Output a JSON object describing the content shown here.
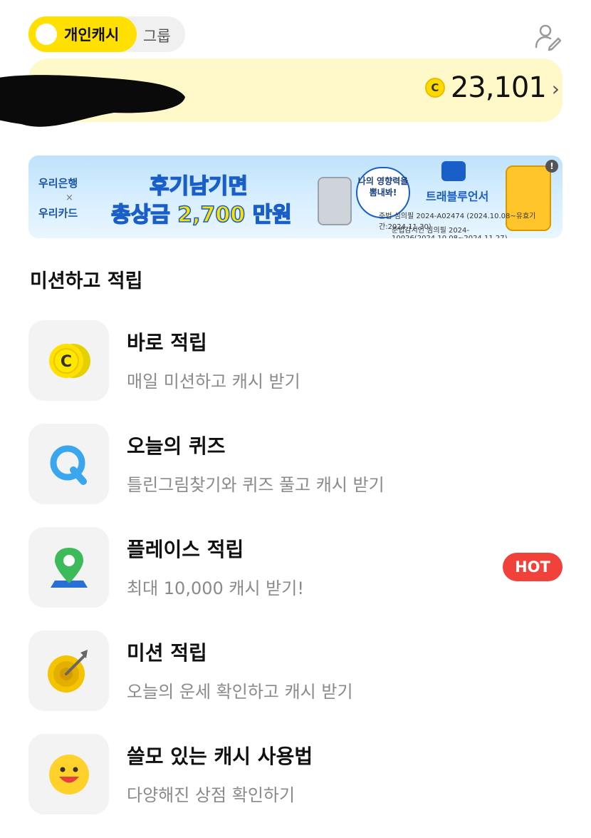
{
  "header": {
    "toggle_active": "개인캐시",
    "toggle_inactive": "그룹",
    "profile_icon": "profile-edit-icon"
  },
  "balance": {
    "coin_symbol": "C",
    "amount": "23,101",
    "chevron": "›"
  },
  "banner": {
    "bank1": "우리은행",
    "cross": "×",
    "bank2": "우리카드",
    "headline1": "후기남기면",
    "headline2": "총상금 2,700 만원",
    "bubble": "나의 영향력을 뽐내봐!",
    "brand": "트래블루언서",
    "fine1": "준법 심의필 2024-A02474 (2024.10.08~유효기간:2024.11.30)",
    "fine2": "준법감시인 심의필 2024-10026(2024.10.08~2024.11.27)",
    "ad_mark": "!"
  },
  "section": {
    "title": "미션하고 적립"
  },
  "missions": [
    {
      "title": "바로 적립",
      "desc": "매일 미션하고 캐시 받기",
      "icon": "cash-coin-icon"
    },
    {
      "title": "오늘의 퀴즈",
      "desc": "틀린그림찾기와 퀴즈 풀고 캐시 받기",
      "icon": "quiz-q-icon"
    },
    {
      "title": "플레이스 적립",
      "desc": "최대 10,000 캐시 받기!",
      "icon": "map-pin-icon",
      "badge": "HOT"
    },
    {
      "title": "미션 적립",
      "desc": "오늘의 운세 확인하고 캐시 받기",
      "icon": "target-dart-icon"
    },
    {
      "title": "쓸모 있는 캐시 사용법",
      "desc": "다양해진 상점 확인하기",
      "icon": "smiley-face-icon"
    }
  ],
  "colors": {
    "accent_yellow": "#ffe000",
    "card_bg": "#fff8c8",
    "hot_red": "#f0413b",
    "quiz_blue": "#3aa6ee",
    "pin_green": "#3dbb5a"
  }
}
